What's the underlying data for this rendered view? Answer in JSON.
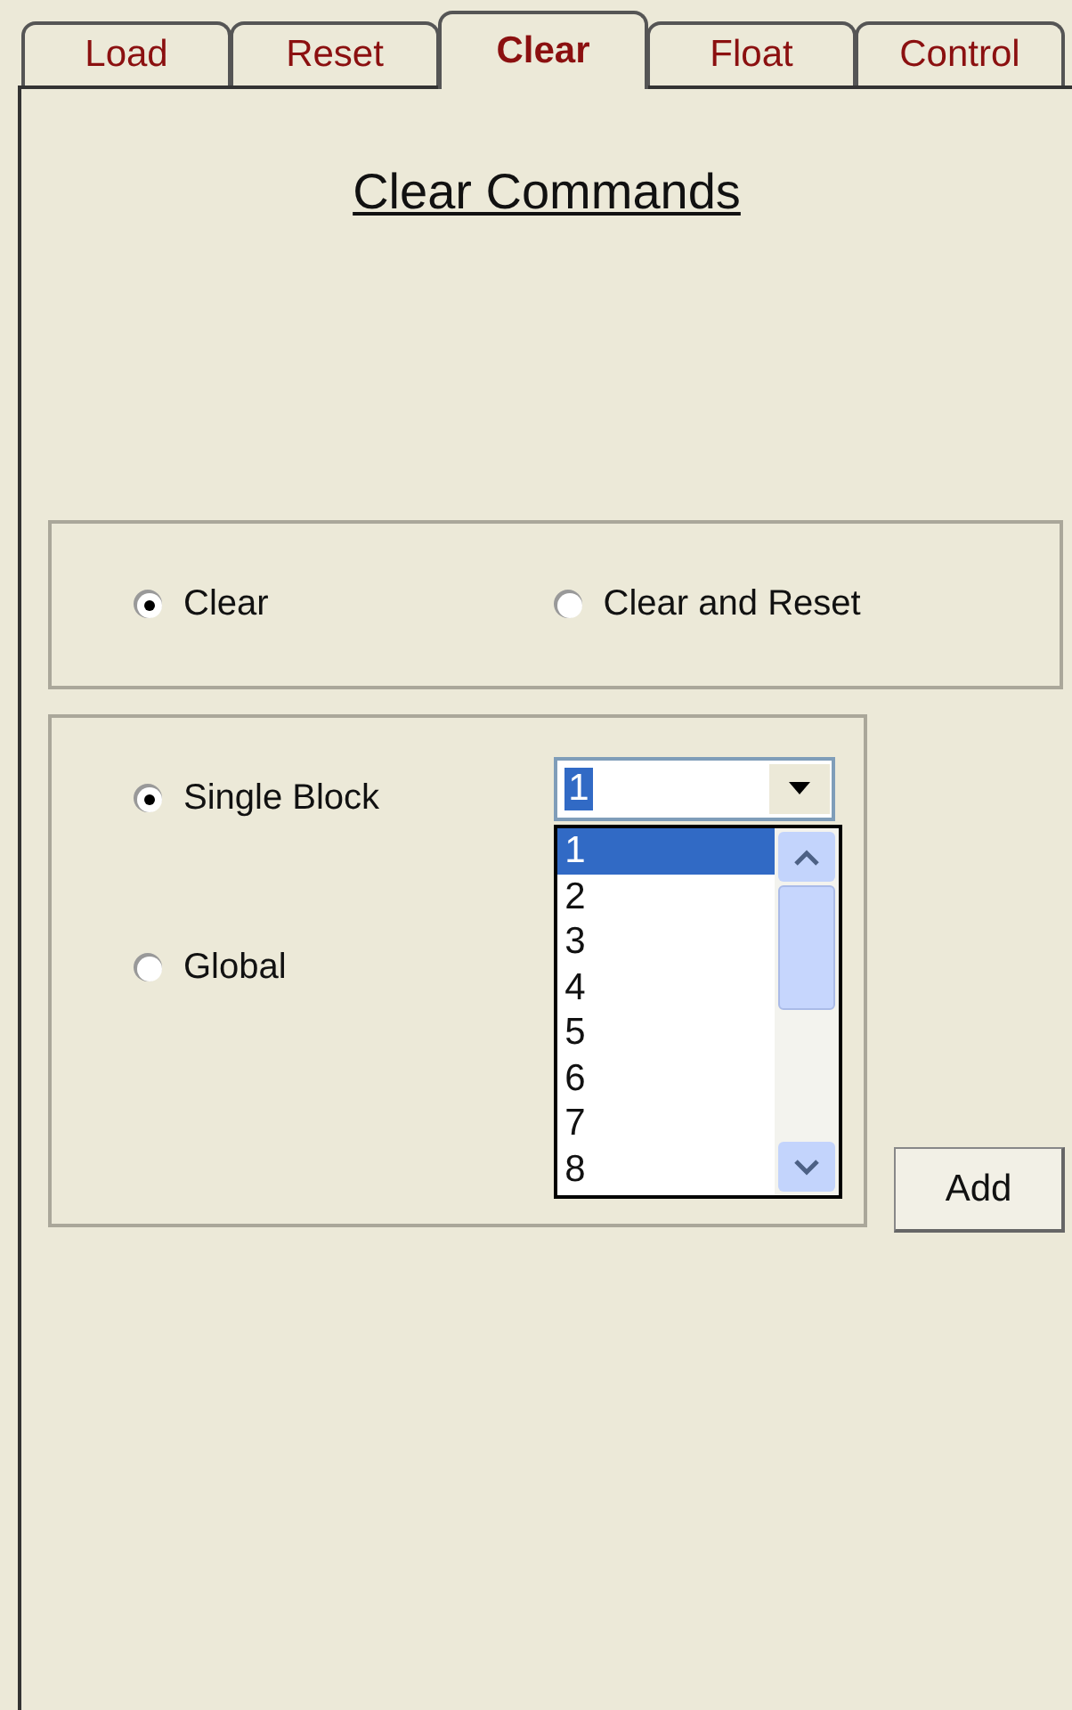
{
  "tabs": [
    {
      "label": "Load",
      "selected": false
    },
    {
      "label": "Reset",
      "selected": false
    },
    {
      "label": "Clear",
      "selected": true
    },
    {
      "label": "Float",
      "selected": false
    },
    {
      "label": "Control",
      "selected": false
    }
  ],
  "title": "Clear Commands",
  "mode_options": [
    {
      "label": "Clear",
      "selected": true
    },
    {
      "label": "Clear and Reset",
      "selected": false
    }
  ],
  "scope_options": [
    {
      "label": "Single Block",
      "selected": true
    },
    {
      "label": "Global",
      "selected": false
    }
  ],
  "block_combo": {
    "value": "1",
    "expanded": true,
    "items": [
      {
        "label": "1",
        "selected": true
      },
      {
        "label": "2",
        "selected": false
      },
      {
        "label": "3",
        "selected": false
      },
      {
        "label": "4",
        "selected": false
      },
      {
        "label": "5",
        "selected": false
      },
      {
        "label": "6",
        "selected": false
      },
      {
        "label": "7",
        "selected": false
      },
      {
        "label": "8",
        "selected": false
      }
    ]
  },
  "add_button": "Add"
}
